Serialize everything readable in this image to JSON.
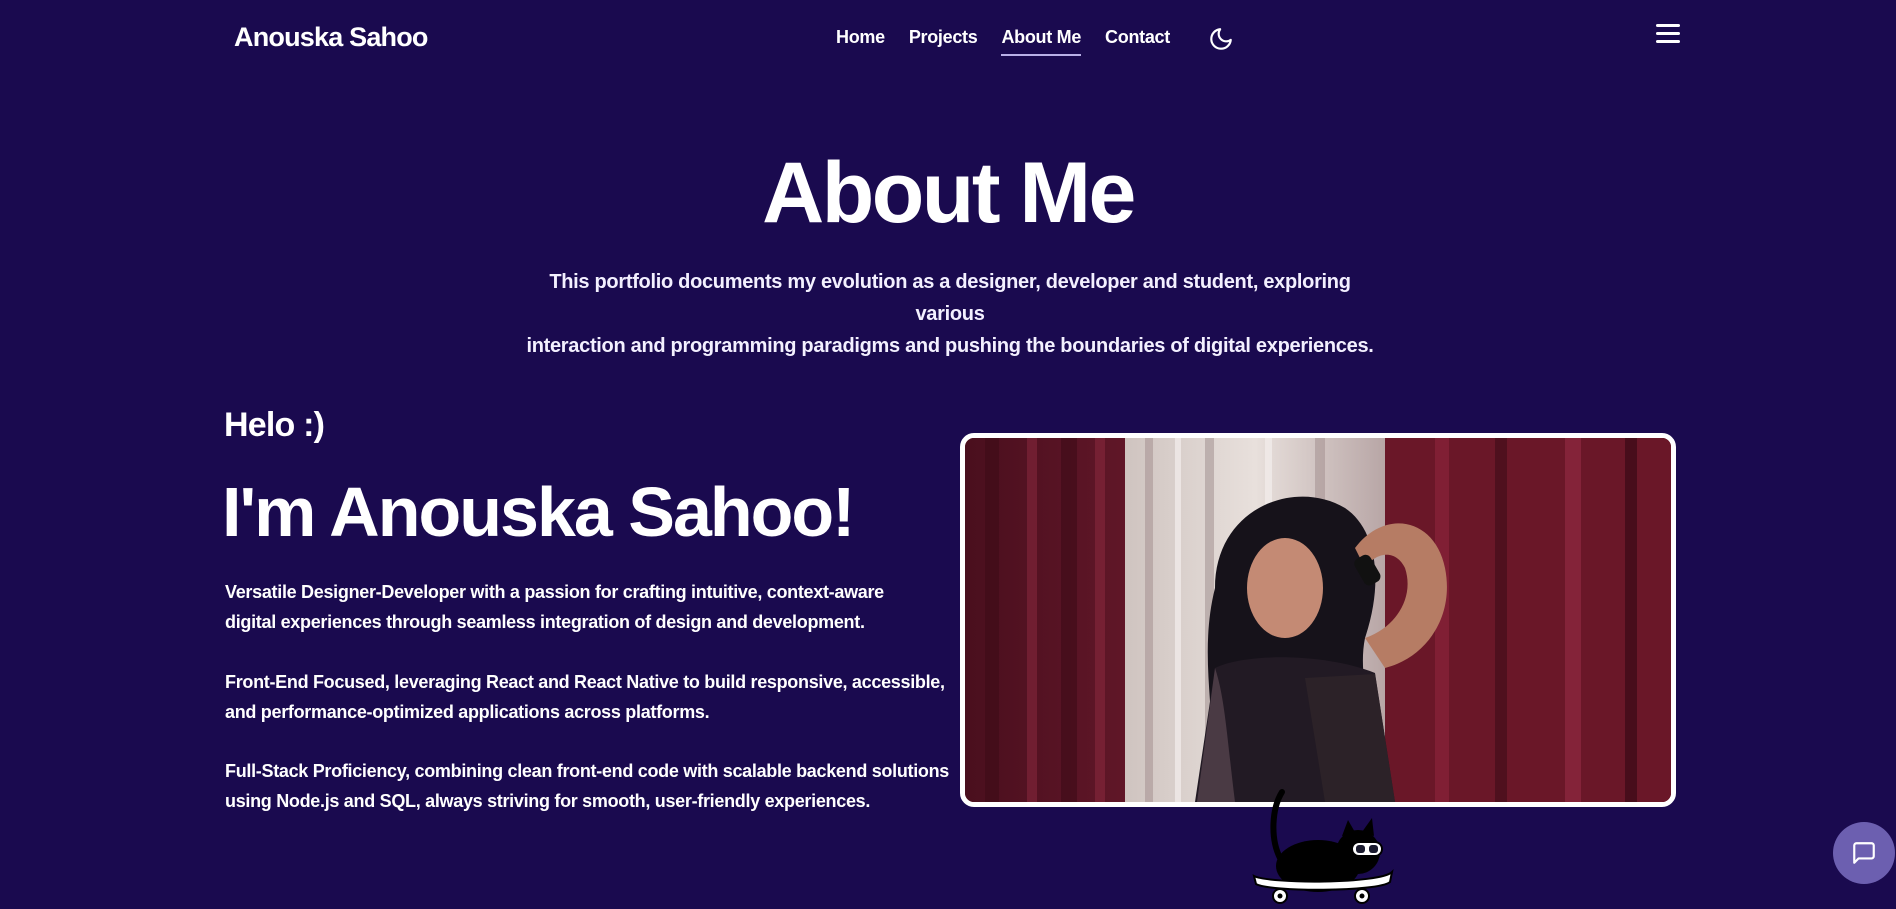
{
  "nav": {
    "logo": "Anouska Sahoo",
    "links": [
      {
        "label": "Home"
      },
      {
        "label": "Projects"
      },
      {
        "label": "About Me",
        "active": true
      },
      {
        "label": "Contact"
      }
    ],
    "theme_icon": "moon-icon",
    "menu_icon": "hamburger-menu-icon"
  },
  "header": {
    "title": "About Me",
    "intro_line1": "This portfolio documents my evolution as a designer, developer and student, exploring various",
    "intro_line2": "interaction and programming paradigms and pushing the boundaries of digital experiences."
  },
  "about": {
    "greeting": "Helo :)",
    "name_heading": "I'm Anouska Sahoo!",
    "paragraphs": [
      {
        "line1": "Versatile Designer-Developer with a passion for crafting intuitive, context-aware",
        "line2": "digital experiences through seamless integration of design and development."
      },
      {
        "line1": "Front-End Focused, leveraging React and React Native to build responsive, accessible,",
        "line2": "and performance-optimized applications across platforms."
      },
      {
        "line1": "Full-Stack Proficiency, combining clean front-end code with scalable backend solutions",
        "line2": "using Node.js and SQL, always striving for smooth, user-friendly experiences."
      }
    ],
    "photo_icon": "profile-photo",
    "mascot_icon": "cat-skateboard-icon"
  },
  "chat": {
    "icon": "chat-bubble-icon"
  },
  "colors": {
    "background": "#1a0a4f",
    "text": "#ffffff",
    "chat_button": "#6c5fb0",
    "active_underline": "#b9b0e8"
  }
}
